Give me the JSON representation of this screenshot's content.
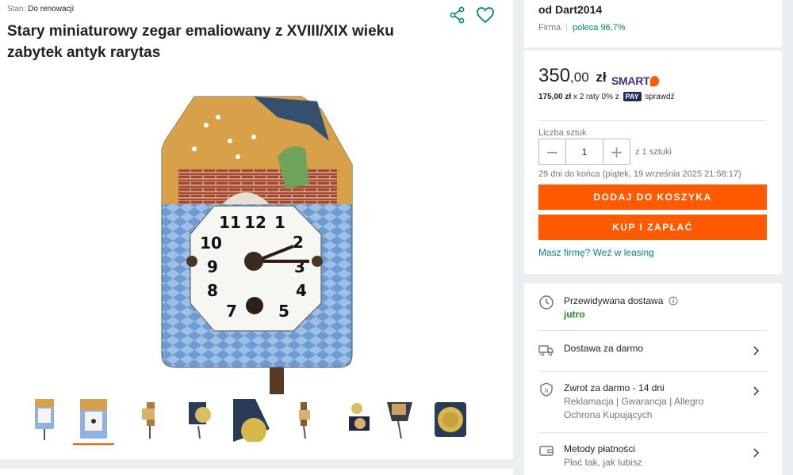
{
  "listing": {
    "condition_label": "Stan:",
    "condition_value": "Do renowacji",
    "title": "Stary miniaturowy zegar emaliowany z XVIII/XIX wieku zabytek antyk rarytas"
  },
  "gallery": {
    "thumbnail_count": 9,
    "active_index": 1
  },
  "seller": {
    "name": "od Dart2014",
    "type": "Firma",
    "recommend": "poleca 96,7%"
  },
  "pricing": {
    "price_main": "350",
    "price_cents": ",00",
    "currency": "zł",
    "smart_label": "SMART",
    "installments_amount": "175,00 zł",
    "installments_text": "x 2 raty 0% z",
    "pay_label": "PAY",
    "check_label": "sprawdź"
  },
  "quantity": {
    "label": "Liczba sztuk",
    "value": "1",
    "minus": "−",
    "plus": "+",
    "of_text": "z 1 sztuki"
  },
  "deadline": "29 dni do końca (piątek, 19 września 2025 21:58:17)",
  "actions": {
    "add_to_cart": "DODAJ DO KOSZYKA",
    "buy_now": "KUP I ZAPŁAĆ",
    "leasing": "Masz firmę? Weź w leasing"
  },
  "delivery": {
    "expected_title": "Przewidywana dostawa",
    "expected_value": "jutro",
    "free_delivery": "Dostawa za darmo",
    "returns_title": "Zwrot za darmo - 14 dni",
    "returns_sub": "Reklamacja | Gwarancja | Allegro Ochrona Kupujących",
    "payment_title": "Metody płatności",
    "payment_sub": "Płać tak, jak lubisz"
  },
  "colors": {
    "accent": "#ff5a00",
    "teal": "#008673",
    "delivery_green": "#1a8a1a"
  }
}
